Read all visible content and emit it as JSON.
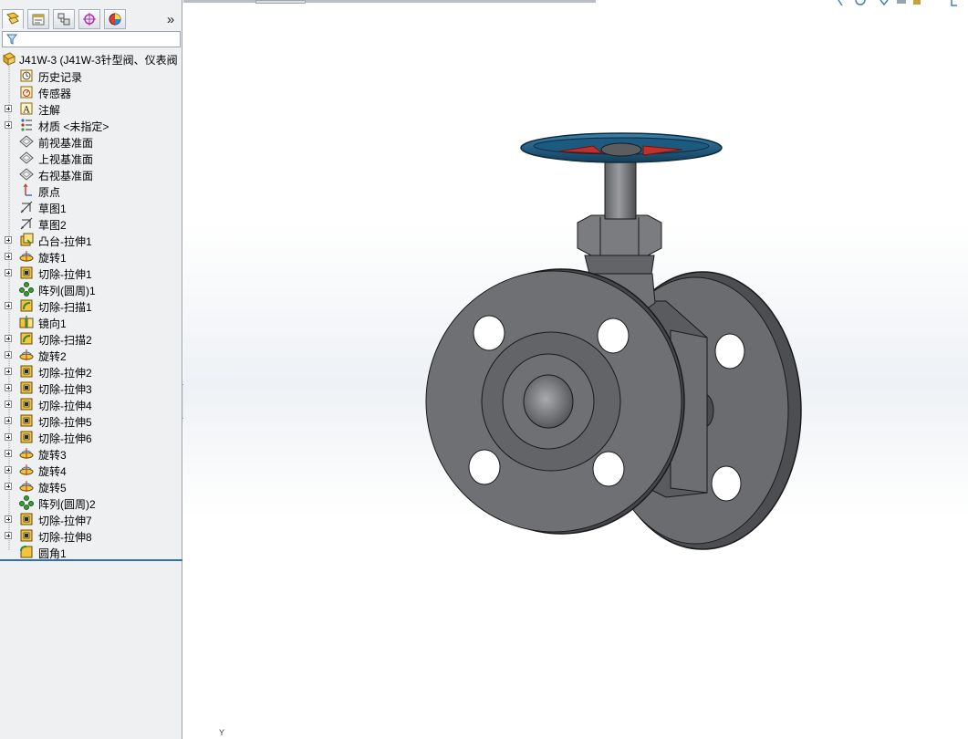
{
  "tabs": [
    {
      "name": "featuremanager",
      "icon": "feature-tree-icon",
      "active": true
    },
    {
      "name": "propertymanager",
      "icon": "property-manager-icon",
      "active": false
    },
    {
      "name": "configurationmanager",
      "icon": "configuration-icon",
      "active": false
    },
    {
      "name": "dimxpert",
      "icon": "dimxpert-icon",
      "active": false
    },
    {
      "name": "display",
      "icon": "display-manager-icon",
      "active": false
    }
  ],
  "tab_more_label": "»",
  "tree": {
    "root_label": "J41W-3  (J41W-3针型阀、仪表阀",
    "items": [
      {
        "label": "历史记录",
        "icon": "history",
        "expandable": false
      },
      {
        "label": "传感器",
        "icon": "sensor",
        "expandable": false
      },
      {
        "label": "注解",
        "icon": "annotation",
        "expandable": true
      },
      {
        "label": "材质 <未指定>",
        "icon": "material",
        "expandable": true
      },
      {
        "label": "前视基准面",
        "icon": "plane",
        "expandable": false
      },
      {
        "label": "上视基准面",
        "icon": "plane",
        "expandable": false
      },
      {
        "label": "右视基准面",
        "icon": "plane",
        "expandable": false
      },
      {
        "label": "原点",
        "icon": "origin",
        "expandable": false
      },
      {
        "label": "草图1",
        "icon": "sketch",
        "expandable": false
      },
      {
        "label": "草图2",
        "icon": "sketch",
        "expandable": false
      },
      {
        "label": "凸台-拉伸1",
        "icon": "boss-extrude",
        "expandable": true
      },
      {
        "label": "旋转1",
        "icon": "revolve",
        "expandable": true
      },
      {
        "label": "切除-拉伸1",
        "icon": "cut-extrude",
        "expandable": true
      },
      {
        "label": "阵列(圆周)1",
        "icon": "circular-pattern",
        "expandable": false
      },
      {
        "label": "切除-扫描1",
        "icon": "cut-sweep",
        "expandable": true
      },
      {
        "label": "镜向1",
        "icon": "mirror",
        "expandable": false
      },
      {
        "label": "切除-扫描2",
        "icon": "cut-sweep",
        "expandable": true
      },
      {
        "label": "旋转2",
        "icon": "revolve",
        "expandable": true
      },
      {
        "label": "切除-拉伸2",
        "icon": "cut-extrude",
        "expandable": true
      },
      {
        "label": "切除-拉伸3",
        "icon": "cut-extrude",
        "expandable": true
      },
      {
        "label": "切除-拉伸4",
        "icon": "cut-extrude",
        "expandable": true
      },
      {
        "label": "切除-拉伸5",
        "icon": "cut-extrude",
        "expandable": true
      },
      {
        "label": "切除-拉伸6",
        "icon": "cut-extrude",
        "expandable": true
      },
      {
        "label": "旋转3",
        "icon": "revolve",
        "expandable": true
      },
      {
        "label": "旋转4",
        "icon": "revolve",
        "expandable": true
      },
      {
        "label": "旋转5",
        "icon": "revolve",
        "expandable": true
      },
      {
        "label": "阵列(圆周)2",
        "icon": "circular-pattern",
        "expandable": false
      },
      {
        "label": "切除-拉伸7",
        "icon": "cut-extrude",
        "expandable": true
      },
      {
        "label": "切除-拉伸8",
        "icon": "cut-extrude",
        "expandable": true
      },
      {
        "label": "圆角1",
        "icon": "fillet",
        "expandable": false
      }
    ]
  },
  "triad_label": "Y",
  "colors": {
    "handwheel": "#1d5a80",
    "body": "#6e7073",
    "panel_bg": "#eef0f2",
    "accent": "#2f6fb3"
  }
}
